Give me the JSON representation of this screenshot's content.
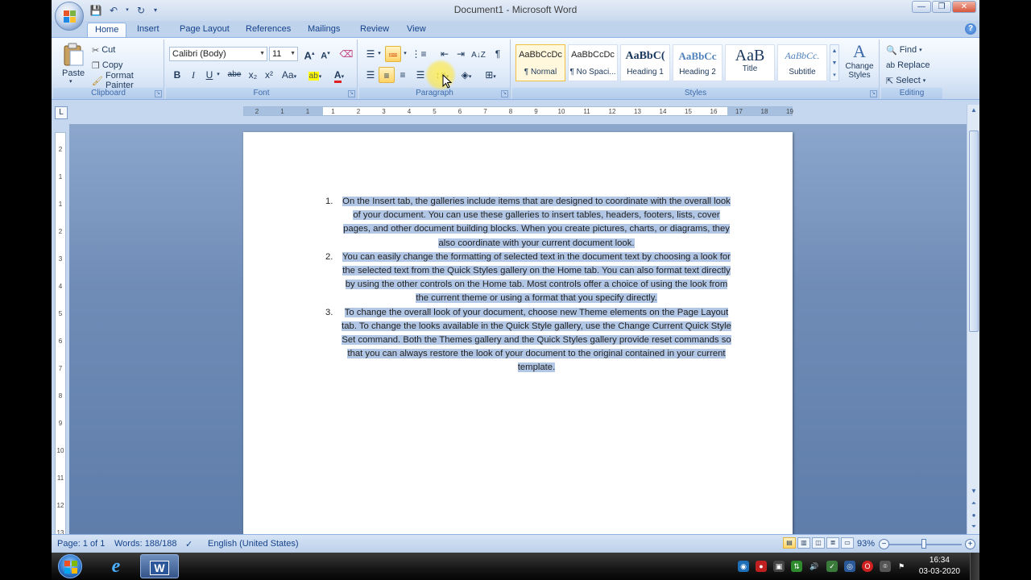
{
  "window": {
    "title": "Document1 - Microsoft Word"
  },
  "tabs": [
    {
      "label": "Home",
      "active": true
    },
    {
      "label": "Insert"
    },
    {
      "label": "Page Layout"
    },
    {
      "label": "References"
    },
    {
      "label": "Mailings"
    },
    {
      "label": "Review"
    },
    {
      "label": "View"
    }
  ],
  "ribbon": {
    "clipboard": {
      "paste": "Paste",
      "cut": "Cut",
      "copy": "Copy",
      "format_painter": "Format Painter",
      "label": "Clipboard"
    },
    "font": {
      "font_name": "Calibri (Body)",
      "font_size": "11",
      "label": "Font",
      "bold": "B",
      "italic": "I",
      "underline": "U",
      "strike": "abe",
      "subscript": "x₂",
      "superscript": "x²",
      "change_case": "Aa",
      "grow": "A",
      "shrink": "A",
      "font_color": "A"
    },
    "paragraph": {
      "label": "Paragraph"
    },
    "styles": {
      "label": "Styles",
      "items": [
        {
          "sample": "AaBbCcDc",
          "name": "¶ Normal"
        },
        {
          "sample": "AaBbCcDc",
          "name": "¶ No Spaci..."
        },
        {
          "sample": "AaBbC(",
          "name": "Heading 1"
        },
        {
          "sample": "AaBbCc",
          "name": "Heading 2"
        },
        {
          "sample": "AaB",
          "name": "Title"
        },
        {
          "sample": "AaBbCc.",
          "name": "Subtitle"
        }
      ],
      "change_styles": "Change Styles"
    },
    "editing": {
      "label": "Editing",
      "find": "Find",
      "replace": "Replace",
      "select": "Select"
    }
  },
  "ruler": {
    "ticks": [
      "2",
      "1",
      "1",
      "1",
      "2",
      "3",
      "4",
      "5",
      "6",
      "7",
      "8",
      "9",
      "10",
      "11",
      "12",
      "13",
      "14",
      "15",
      "16",
      "17",
      "18",
      "19"
    ]
  },
  "vruler": {
    "ticks": [
      "2",
      "1",
      "1",
      "2",
      "3",
      "4",
      "5",
      "6",
      "7",
      "8",
      "9",
      "10",
      "11",
      "12",
      "13"
    ]
  },
  "document": {
    "items": [
      {
        "num": "1.",
        "text": "On the Insert tab, the galleries include items that are designed to coordinate with the overall look of your document. You can use these galleries to insert tables, headers, footers, lists, cover pages, and other document building blocks. When you create pictures, charts, or diagrams, they also coordinate with your current document look."
      },
      {
        "num": "2.",
        "text": "You can easily change the formatting of selected text in the document text by choosing a look for the selected text from the Quick Styles gallery on the Home tab. You can also format text directly by using the other controls on the Home tab. Most controls offer a choice of using the look from the current theme or using a format that you specify directly."
      },
      {
        "num": "3.",
        "text": "To change the overall look of your document, choose new Theme elements on the Page Layout tab. To change the looks available in the Quick Style gallery, use the Change Current Quick Style Set command. Both the Themes gallery and the Quick Styles gallery provide reset commands so that you can always restore the look of your document to the original contained in your current template."
      }
    ]
  },
  "status": {
    "page": "Page: 1 of 1",
    "words": "Words: 188/188",
    "language": "English (United States)",
    "zoom": "93%",
    "zoom_minus": "−",
    "zoom_plus": "+"
  },
  "taskbar": {
    "word_app": "W",
    "clock_time": "16:34",
    "clock_date": "03-03-2020"
  },
  "colors": {
    "selection": "#b2c7e6",
    "ribbon_blue": "#15428b"
  }
}
